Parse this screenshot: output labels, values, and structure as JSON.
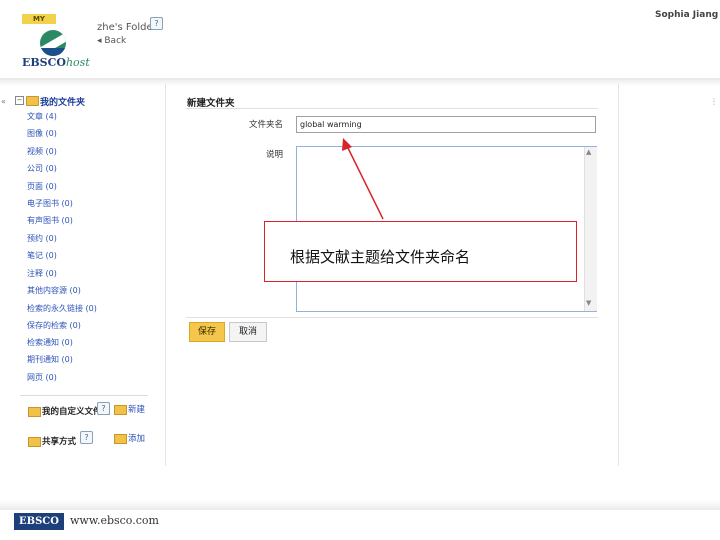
{
  "header": {
    "my_tab": "MY",
    "logo_main": "EBSCO",
    "logo_host": "host",
    "folder_title": "zhe's Folder",
    "back_link": "◂ Back",
    "help": "?",
    "user_name": "Sophia Jiang"
  },
  "sidebar": {
    "collapse_left": "«",
    "tree_toggle": "−",
    "root_folder": "我的文件夹",
    "items": [
      {
        "label": "文章 (4)"
      },
      {
        "label": "图像 (0)"
      },
      {
        "label": "视频 (0)"
      },
      {
        "label": "公司 (0)"
      },
      {
        "label": "页面 (0)"
      },
      {
        "label": "电子图书 (0)"
      },
      {
        "label": "有声图书 (0)"
      },
      {
        "label": "预约 (0)"
      },
      {
        "label": "笔记 (0)"
      },
      {
        "label": "注释 (0)"
      },
      {
        "label": "其他内容源 (0)"
      },
      {
        "label": "检索的永久链接 (0)"
      },
      {
        "label": "保存的检索 (0)"
      },
      {
        "label": "检索通知 (0)"
      },
      {
        "label": "期刊通知 (0)"
      },
      {
        "label": "网页 (0)"
      }
    ],
    "custom_folders": {
      "label": "我的自定义文件夹",
      "action": "新建"
    },
    "shared": {
      "label": "共享方式",
      "action": "添加"
    }
  },
  "form": {
    "title": "新建文件夹",
    "name_label": "文件夹名",
    "name_value": "global warming",
    "desc_label": "说明",
    "desc_value": "",
    "scroll_up": "▲",
    "scroll_down": "▼",
    "save_label": "保存",
    "cancel_label": "取消"
  },
  "annotation": {
    "text": "根据文献主题给文件夹命名",
    "color": "#d8242a"
  },
  "footer": {
    "logo": "EBSCO",
    "url": "www.ebsco.com"
  },
  "colors": {
    "accent_yellow": "#f4c64a",
    "link_blue": "#2b53b8",
    "ebsco_navy": "#1d3f7a",
    "ebsco_green": "#2b8a63"
  }
}
